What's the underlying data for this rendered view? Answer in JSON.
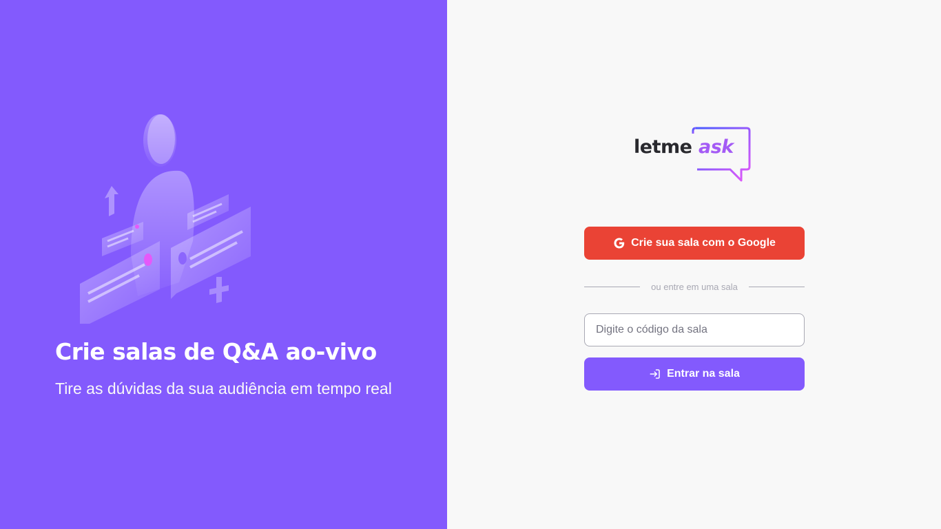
{
  "aside": {
    "title": "Crie salas de Q&A ao-vivo",
    "subtitle": "Tire as dúvidas da sua audiência em tempo real",
    "illustration_icon": "qa-illustration"
  },
  "logo": {
    "text_primary": "letme",
    "text_accent": "ask",
    "icon": "speech-bubble-icon"
  },
  "actions": {
    "google_button_label": "Crie sua sala com o Google",
    "google_icon": "google-icon",
    "separator_text": "ou entre em uma sala",
    "room_code_placeholder": "Digite o código da sala",
    "room_code_value": "",
    "enter_button_label": "Entrar na sala",
    "enter_icon": "login-icon"
  },
  "colors": {
    "aside_bg": "#835afd",
    "main_bg": "#f8f8f8",
    "google_red": "#ea4335",
    "primary_purple": "#835afd",
    "logo_dark": "#29292e",
    "logo_gradient_start": "#485bff",
    "logo_gradient_end": "#e559f9"
  }
}
